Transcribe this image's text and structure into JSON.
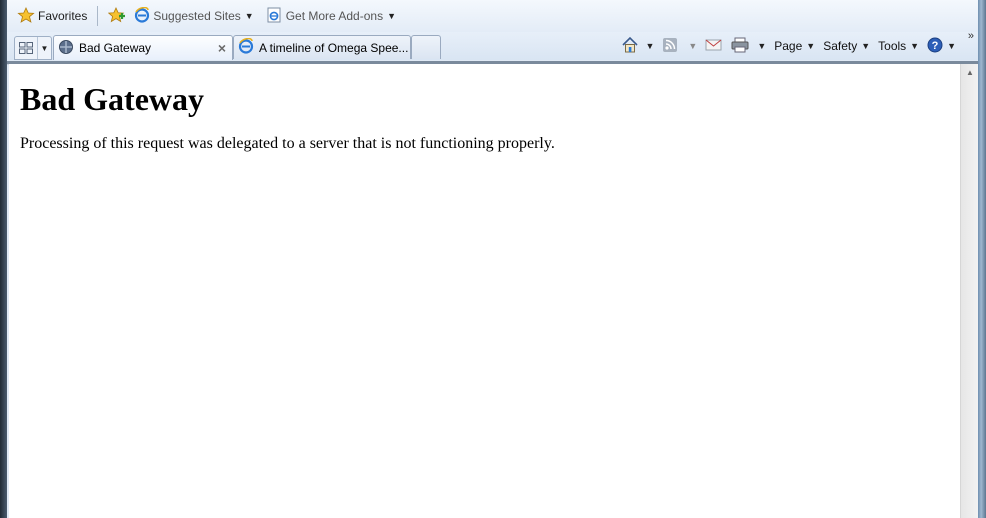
{
  "favorites_bar": {
    "favorites_label": "Favorites",
    "suggested_sites_label": "Suggested Sites",
    "get_addons_label": "Get More Add-ons"
  },
  "tabs": [
    {
      "title": "Bad Gateway",
      "active": true
    },
    {
      "title": "A timeline of Omega Spee...",
      "active": false
    }
  ],
  "command_bar": {
    "page_label": "Page",
    "safety_label": "Safety",
    "tools_label": "Tools",
    "overflow": "»"
  },
  "page": {
    "heading": "Bad Gateway",
    "message": "Processing of this request was delegated to a server that is not functioning properly."
  },
  "colors": {
    "accent": "#1f5fb4",
    "toolbar": "#e3ecf7"
  },
  "icons": [
    "favorites-star-icon",
    "add-favorites-icon",
    "ie-logo-icon",
    "quick-tabs-icon",
    "home-icon",
    "feeds-icon",
    "mail-icon",
    "print-icon",
    "help-icon"
  ]
}
